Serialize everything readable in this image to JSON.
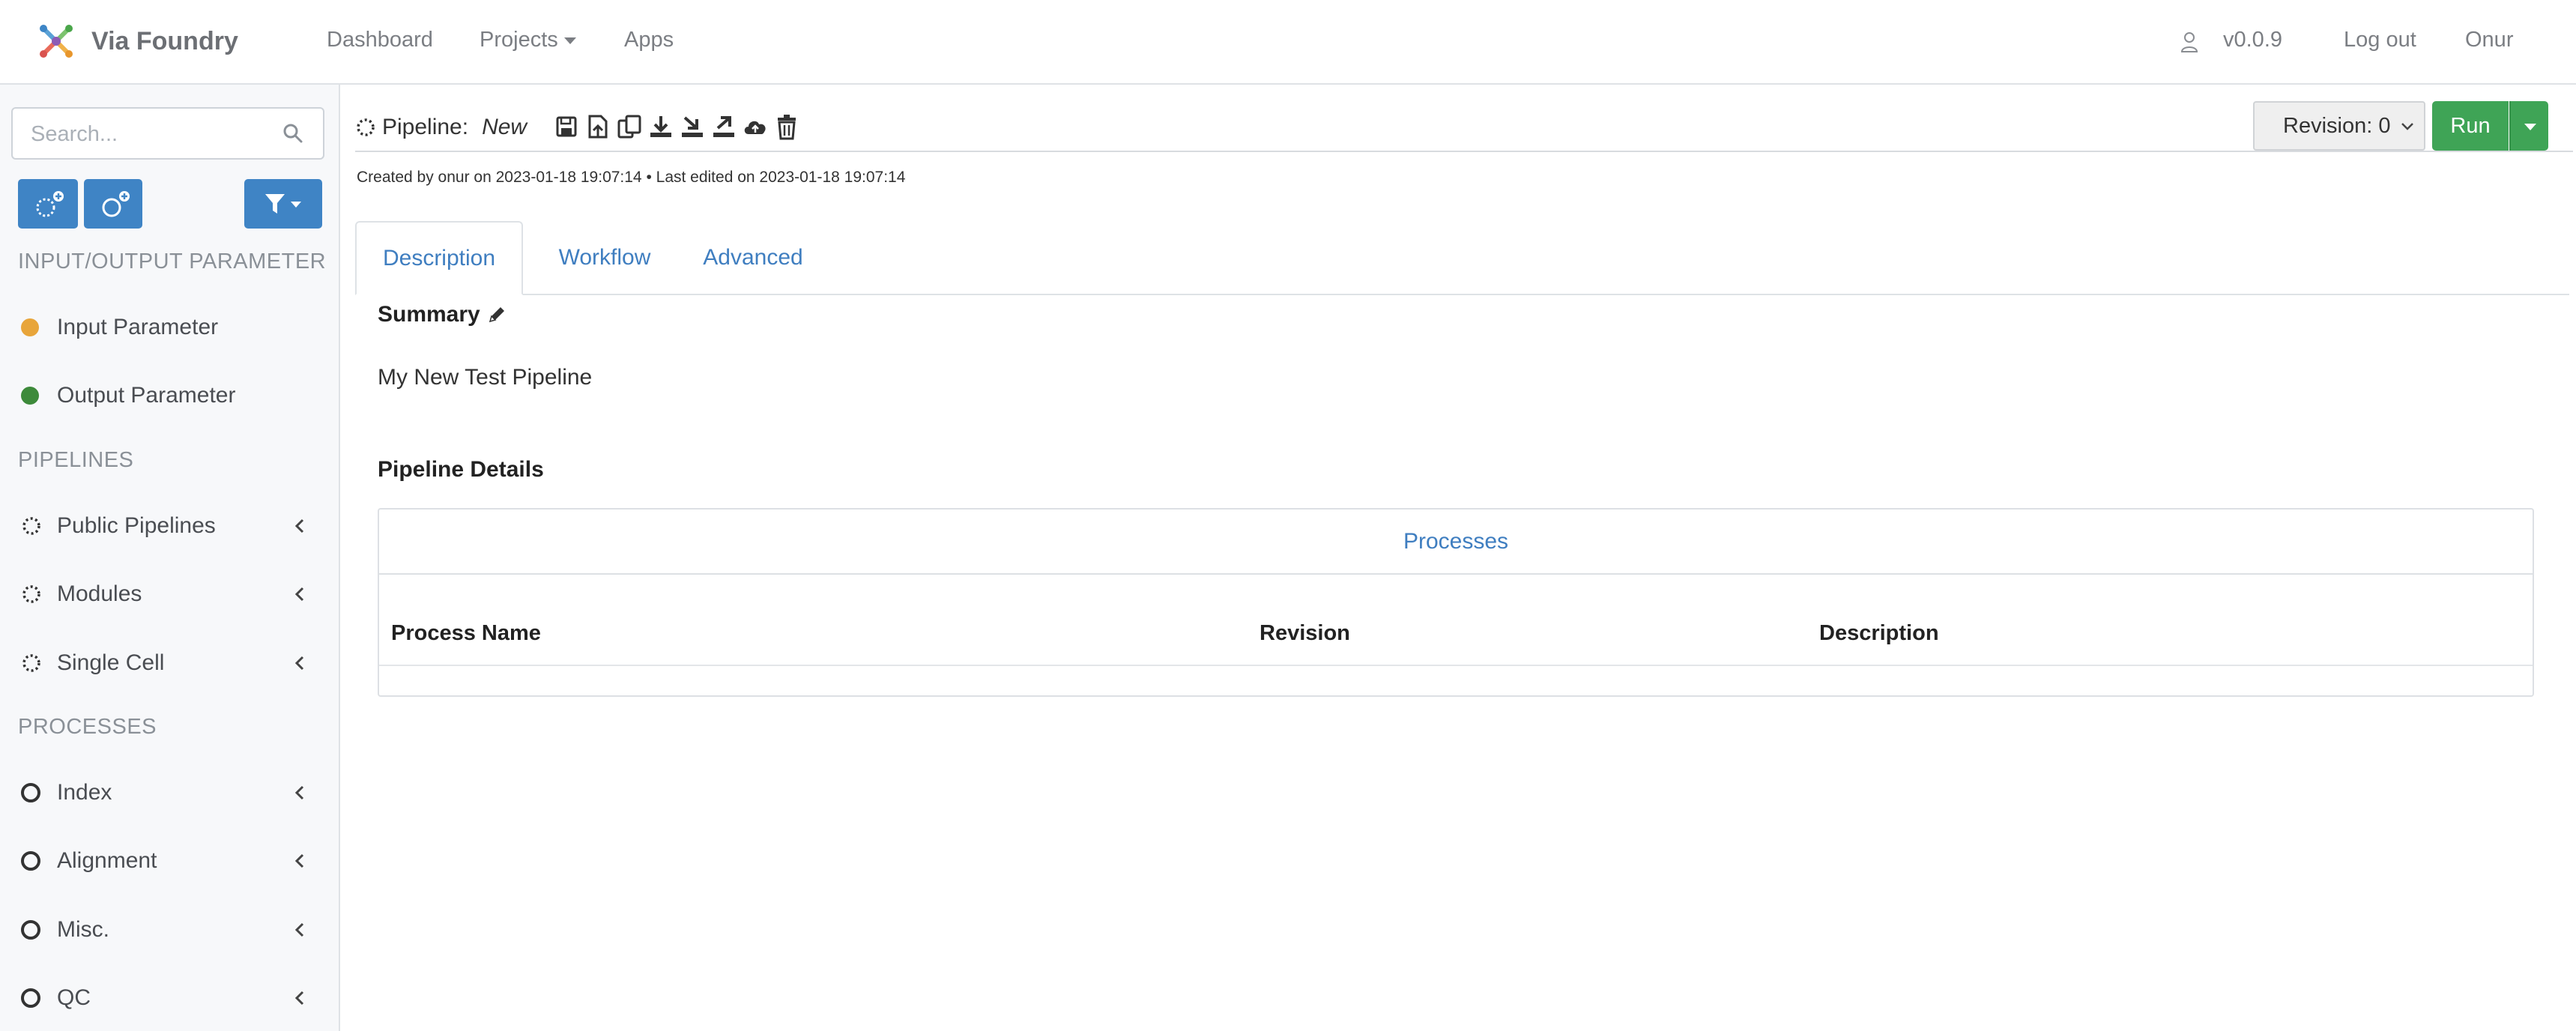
{
  "navbar": {
    "brand": "Via Foundry",
    "links": {
      "dashboard": "Dashboard",
      "projects": "Projects",
      "apps": "Apps"
    },
    "version": "v0.0.9",
    "logout": "Log out",
    "user": "Onur"
  },
  "sidebar": {
    "search_placeholder": "Search...",
    "sections": {
      "io": "INPUT/OUTPUT PARAMETER",
      "pipelines": "PIPELINES",
      "processes": "PROCESSES"
    },
    "io_items": [
      {
        "label": "Input Parameter",
        "color": "#e8a53a"
      },
      {
        "label": "Output Parameter",
        "color": "#3d8a3a"
      }
    ],
    "pipeline_items": [
      {
        "label": "Public Pipelines"
      },
      {
        "label": "Modules"
      },
      {
        "label": "Single Cell"
      }
    ],
    "process_items": [
      {
        "label": "Index"
      },
      {
        "label": "Alignment"
      },
      {
        "label": "Misc."
      },
      {
        "label": "QC"
      }
    ]
  },
  "pipeline": {
    "label": "Pipeline:",
    "name": "New",
    "meta": "Created by onur on 2023-01-18 19:07:14 • Last edited on 2023-01-18 19:07:14",
    "revision": "Revision: 0",
    "run": "Run",
    "toolbar_icons": [
      "save-icon",
      "save-as-icon",
      "duplicate-icon",
      "download-icon",
      "export-icon",
      "import-icon",
      "cloud-upload-icon",
      "trash-icon"
    ]
  },
  "tabs": [
    "Description",
    "Workflow",
    "Advanced"
  ],
  "description": {
    "summary_title": "Summary",
    "summary_text": "My New Test Pipeline",
    "details_title": "Pipeline Details",
    "processes_header": "Processes",
    "columns": [
      "Process Name",
      "Revision",
      "Description"
    ]
  },
  "colors": {
    "accent": "#3f84c5",
    "run": "#3fa456",
    "link": "#3f7ec0"
  }
}
